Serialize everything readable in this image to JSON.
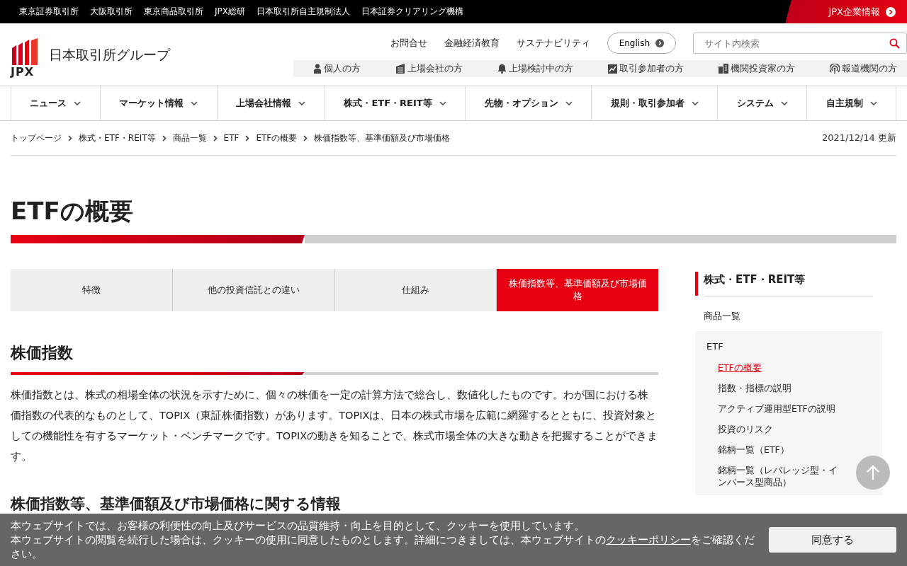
{
  "top_bar": {
    "links": [
      "東京証券取引所",
      "大阪取引所",
      "東京商品取引所",
      "JPX総研",
      "日本取引所自主規制法人",
      "日本証券クリアリング機構"
    ],
    "corporate_link": "JPX企業情報"
  },
  "header": {
    "logo_mark": "JPX",
    "logo_text": "日本取引所グループ",
    "utility_links": [
      "お問合せ",
      "金融経済教育",
      "サステナビリティ"
    ],
    "language_button": "English",
    "search": {
      "placeholder": "サイト内検索"
    },
    "audience_links": [
      {
        "kind": "person",
        "label": "個人の方"
      },
      {
        "kind": "building",
        "label": "上場会社の方"
      },
      {
        "kind": "bell",
        "label": "上場検討中の方"
      },
      {
        "kind": "chart",
        "label": "取引参加者の方"
      },
      {
        "kind": "office",
        "label": "機関投資家の方"
      },
      {
        "kind": "broadcast",
        "label": "報道機関の方"
      }
    ]
  },
  "main_nav": [
    "ニュース",
    "マーケット情報",
    "上場会社情報",
    "株式・ETF・REIT等",
    "先物・オプション",
    "規則・取引参加者",
    "システム",
    "自主規制"
  ],
  "breadcrumb": [
    "トップページ",
    "株式・ETF・REIT等",
    "商品一覧",
    "ETF",
    "ETFの概要",
    "株価指数等、基準価額及び市場価格"
  ],
  "updated": "2021/12/14 更新",
  "page_title": "ETFの概要",
  "tabs": [
    {
      "label": "特徴",
      "selected": false
    },
    {
      "label": "他の投資信託との違い",
      "selected": false
    },
    {
      "label": "仕組み",
      "selected": false
    },
    {
      "label": "株価指数等、基準価額及び市場価格",
      "selected": true
    }
  ],
  "section": {
    "heading": "株価指数",
    "body": "株価指数とは、株式の相場全体の状況を示すために、個々の株価を一定の計算方法で総合し、数値化したものです。わが国における株価指数の代表的なものとして、TOPIX（東証株価指数）があります。TOPIXは、日本の株式市場を広範に網羅するとともに、投資対象としての機能性を有するマーケット・ベンチマークです。TOPIXの動きを知ることで、株式市場全体の大きな動きを把握することができます。"
  },
  "section_2": {
    "heading": "株価指数等、基準価額及び市場価格に関する情報"
  },
  "sidebar": {
    "title": "株式・ETF・REIT等",
    "parent": "商品一覧",
    "group": "ETF",
    "items": [
      {
        "label": "ETFの概要",
        "selected": true
      },
      {
        "label": "指数・指標の説明",
        "selected": false
      },
      {
        "label": "アクティブ運用型ETFの説明",
        "selected": false
      },
      {
        "label": "投資のリスク",
        "selected": false
      },
      {
        "label": "銘柄一覧（ETF）",
        "selected": false
      },
      {
        "label": "銘柄一覧（レバレッジ型・インバース型商品）",
        "selected": false
      }
    ]
  },
  "cookie_banner": {
    "line_1": "本ウェブサイトでは、お客様の利便性の向上及びサービスの品質維持・向上を目的として、クッキーを使用しています。",
    "line_2": "本ウェブサイトの閲覧を続行した場合は、クッキーの使用に同意したものとします。詳細につきましては、本ウェブサイトの",
    "link": "クッキーポリシー",
    "line_3": "をご確認ください。",
    "accept_button": "同意する"
  }
}
